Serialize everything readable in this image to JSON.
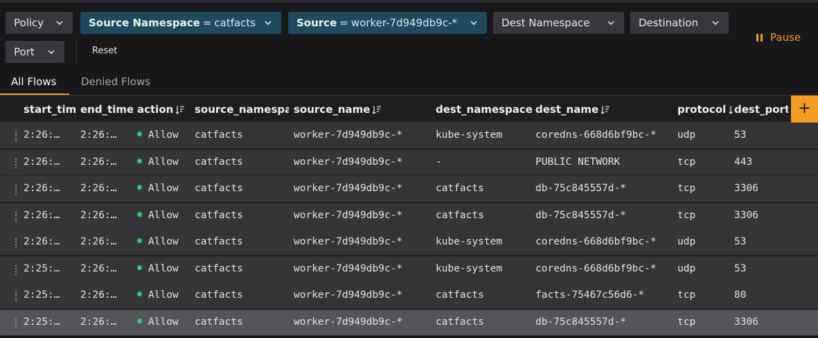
{
  "filters": {
    "policy": "Policy",
    "source_ns_key": "Source Namespace",
    "source_ns_value": "catfacts",
    "source_key": "Source",
    "source_value": "worker-7d949db9c-*",
    "dest_ns": "Dest Namespace",
    "destination": "Destination",
    "port": "Port",
    "eq": "=",
    "reset": "Reset"
  },
  "pause_label": "Pause",
  "tabs": [
    {
      "label": "All Flows",
      "active": true
    },
    {
      "label": "Denied Flows",
      "active": false
    }
  ],
  "columns": [
    "start_time",
    "end_time",
    "action",
    "source_namespace",
    "source_name",
    "dest_namespace",
    "dest_name",
    "protocol",
    "dest_port"
  ],
  "add_column_label": "+",
  "rows": [
    {
      "start_time": "2:26:…",
      "end_time": "2:26:…",
      "action": "Allow",
      "source_namespace": "catfacts",
      "source_name": "worker-7d949db9c-*",
      "dest_namespace": "kube-system",
      "dest_name": "coredns-668d6bf9bc-*",
      "protocol": "udp",
      "dest_port": "53"
    },
    {
      "start_time": "2:26:…",
      "end_time": "2:26:…",
      "action": "Allow",
      "source_namespace": "catfacts",
      "source_name": "worker-7d949db9c-*",
      "dest_namespace": "-",
      "dest_name": "PUBLIC NETWORK",
      "protocol": "tcp",
      "dest_port": "443"
    },
    {
      "start_time": "2:26:…",
      "end_time": "2:26:…",
      "action": "Allow",
      "source_namespace": "catfacts",
      "source_name": "worker-7d949db9c-*",
      "dest_namespace": "catfacts",
      "dest_name": "db-75c845557d-*",
      "protocol": "tcp",
      "dest_port": "3306"
    },
    {
      "start_time": "2:26:…",
      "end_time": "2:26:…",
      "action": "Allow",
      "source_namespace": "catfacts",
      "source_name": "worker-7d949db9c-*",
      "dest_namespace": "catfacts",
      "dest_name": "db-75c845557d-*",
      "protocol": "tcp",
      "dest_port": "3306"
    },
    {
      "start_time": "2:26:…",
      "end_time": "2:26:…",
      "action": "Allow",
      "source_namespace": "catfacts",
      "source_name": "worker-7d949db9c-*",
      "dest_namespace": "kube-system",
      "dest_name": "coredns-668d6bf9bc-*",
      "protocol": "udp",
      "dest_port": "53"
    },
    {
      "start_time": "2:25:…",
      "end_time": "2:26:…",
      "action": "Allow",
      "source_namespace": "catfacts",
      "source_name": "worker-7d949db9c-*",
      "dest_namespace": "kube-system",
      "dest_name": "coredns-668d6bf9bc-*",
      "protocol": "udp",
      "dest_port": "53"
    },
    {
      "start_time": "2:25:…",
      "end_time": "2:26:…",
      "action": "Allow",
      "source_namespace": "catfacts",
      "source_name": "worker-7d949db9c-*",
      "dest_namespace": "catfacts",
      "dest_name": "facts-75467c56d6-*",
      "protocol": "tcp",
      "dest_port": "80"
    },
    {
      "start_time": "2:25:…",
      "end_time": "2:26:…",
      "action": "Allow",
      "source_namespace": "catfacts",
      "source_name": "worker-7d949db9c-*",
      "dest_namespace": "catfacts",
      "dest_name": "db-75c845557d-*",
      "protocol": "tcp",
      "dest_port": "3306"
    }
  ],
  "colors": {
    "accent": "#f59a23",
    "allow": "#2ecc71",
    "active_chip": "#1e4a5c"
  }
}
